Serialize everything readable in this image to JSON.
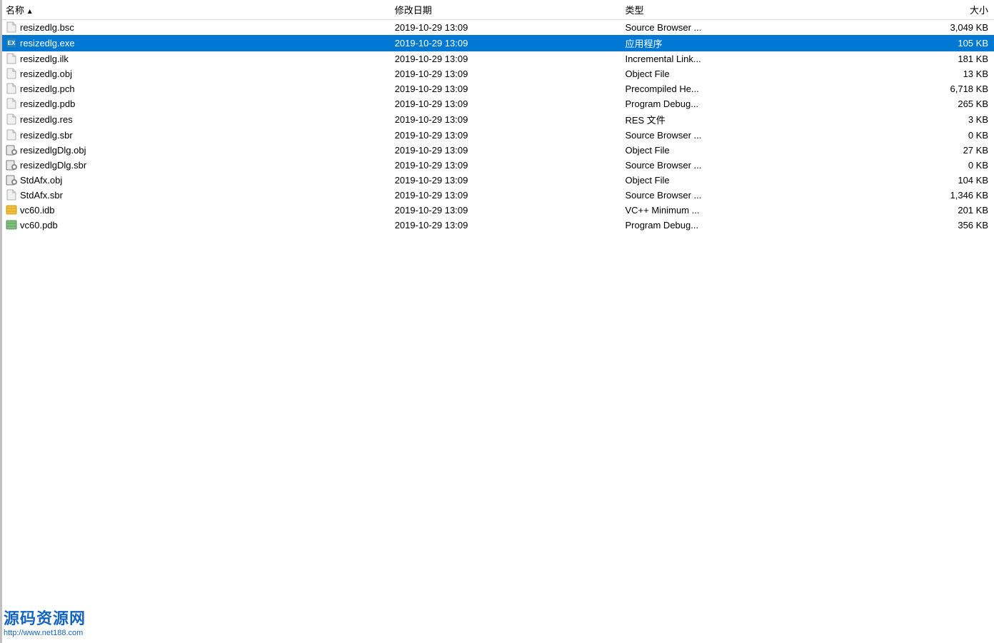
{
  "columns": [
    {
      "key": "name",
      "label": "名称",
      "sortable": true
    },
    {
      "key": "date",
      "label": "修改日期"
    },
    {
      "key": "type",
      "label": "类型"
    },
    {
      "key": "size",
      "label": "大小"
    }
  ],
  "files": [
    {
      "name": "resizedlg.bsc",
      "date": "2019-10-29 13:09",
      "type": "Source Browser ...",
      "size": "3,049 KB",
      "icon": "generic",
      "selected": false
    },
    {
      "name": "resizedlg.exe",
      "date": "2019-10-29 13:09",
      "type": "应用程序",
      "size": "105 KB",
      "icon": "exe",
      "selected": true
    },
    {
      "name": "resizedlg.ilk",
      "date": "2019-10-29 13:09",
      "type": "Incremental Link...",
      "size": "181 KB",
      "icon": "generic",
      "selected": false
    },
    {
      "name": "resizedlg.obj",
      "date": "2019-10-29 13:09",
      "type": "Object File",
      "size": "13 KB",
      "icon": "generic",
      "selected": false
    },
    {
      "name": "resizedlg.pch",
      "date": "2019-10-29 13:09",
      "type": "Precompiled He...",
      "size": "6,718 KB",
      "icon": "generic",
      "selected": false
    },
    {
      "name": "resizedlg.pdb",
      "date": "2019-10-29 13:09",
      "type": "Program Debug...",
      "size": "265 KB",
      "icon": "generic",
      "selected": false
    },
    {
      "name": "resizedlg.res",
      "date": "2019-10-29 13:09",
      "type": "RES 文件",
      "size": "3 KB",
      "icon": "generic",
      "selected": false
    },
    {
      "name": "resizedlg.sbr",
      "date": "2019-10-29 13:09",
      "type": "Source Browser ...",
      "size": "0 KB",
      "icon": "generic",
      "selected": false
    },
    {
      "name": "resizedlgDlg.obj",
      "date": "2019-10-29 13:09",
      "type": "Object File",
      "size": "27 KB",
      "icon": "gear",
      "selected": false
    },
    {
      "name": "resizedlgDlg.sbr",
      "date": "2019-10-29 13:09",
      "type": "Source Browser ...",
      "size": "0 KB",
      "icon": "gear",
      "selected": false
    },
    {
      "name": "StdAfx.obj",
      "date": "2019-10-29 13:09",
      "type": "Object File",
      "size": "104 KB",
      "icon": "gear",
      "selected": false
    },
    {
      "name": "StdAfx.sbr",
      "date": "2019-10-29 13:09",
      "type": "Source Browser ...",
      "size": "1,346 KB",
      "icon": "generic",
      "selected": false
    },
    {
      "name": "vc60.idb",
      "date": "2019-10-29 13:09",
      "type": "VC++ Minimum ...",
      "size": "201 KB",
      "icon": "idb",
      "selected": false
    },
    {
      "name": "vc60.pdb",
      "date": "2019-10-29 13:09",
      "type": "Program Debug...",
      "size": "356 KB",
      "icon": "pdb",
      "selected": false
    }
  ],
  "watermark": {
    "title": "源码资源网",
    "url": "http://www.net188.com"
  }
}
